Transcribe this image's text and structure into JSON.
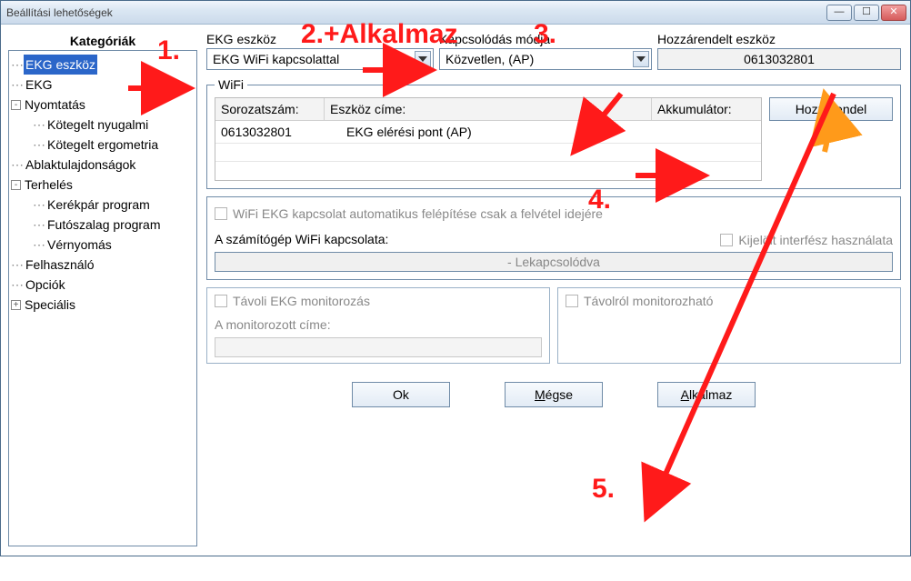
{
  "window": {
    "title": "Beállítási lehetőségek"
  },
  "sidebar": {
    "heading": "Kategóriák",
    "items": [
      {
        "label": "EKG eszköz",
        "selected": true,
        "depth": 0
      },
      {
        "label": "EKG",
        "depth": 0
      },
      {
        "label": "Nyomtatás",
        "depth": 0,
        "expander": "-"
      },
      {
        "label": "Kötegelt nyugalmi",
        "depth": 1
      },
      {
        "label": "Kötegelt ergometria",
        "depth": 1
      },
      {
        "label": "Ablaktulajdonságok",
        "depth": 0
      },
      {
        "label": "Terhelés",
        "depth": 0,
        "expander": "-"
      },
      {
        "label": "Kerékpár program",
        "depth": 1
      },
      {
        "label": "Futószalag program",
        "depth": 1
      },
      {
        "label": "Vérnyomás",
        "depth": 1
      },
      {
        "label": "Felhasználó",
        "depth": 0
      },
      {
        "label": "Opciók",
        "depth": 0
      },
      {
        "label": "Speciális",
        "depth": 0,
        "expander": "+"
      }
    ]
  },
  "device_field": {
    "label": "EKG eszköz",
    "value": "EKG WiFi kapcsolattal"
  },
  "conn_field": {
    "label": "Kapcsolódás módja",
    "value": "Közvetlen, (AP)"
  },
  "assigned_field": {
    "label": "Hozzárendelt eszköz",
    "value": "0613032801"
  },
  "wifi": {
    "legend": "WiFi",
    "cols": {
      "serial": "Sorozatszám:",
      "addr": "Eszköz címe:",
      "batt": "Akkumulátor:"
    },
    "row": {
      "serial": "0613032801",
      "addr": "EKG elérési pont (AP)",
      "batt": ""
    },
    "assign_btn": "Hozzárendel"
  },
  "opts": {
    "auto_connect": "WiFi EKG kapcsolat automatikus felépítése csak a felvétel idejére",
    "pc_wifi_label": "A számítógép WiFi kapcsolata:",
    "selected_iface": "Kijelölt interfész használata",
    "status": "- Lekapcsolódva"
  },
  "monitor": {
    "left_label": "Távoli EKG monitorozás",
    "left_sub": "A monitorozott címe:",
    "right_label": "Távolról monitorozható"
  },
  "footer": {
    "ok": "Ok",
    "cancel": "Mégse",
    "apply": "Alkalmaz"
  },
  "annotations": {
    "n1": "1.",
    "n2": "2.+Alkalmaz",
    "n3": "3.",
    "n4": "4.",
    "n5": "5."
  }
}
